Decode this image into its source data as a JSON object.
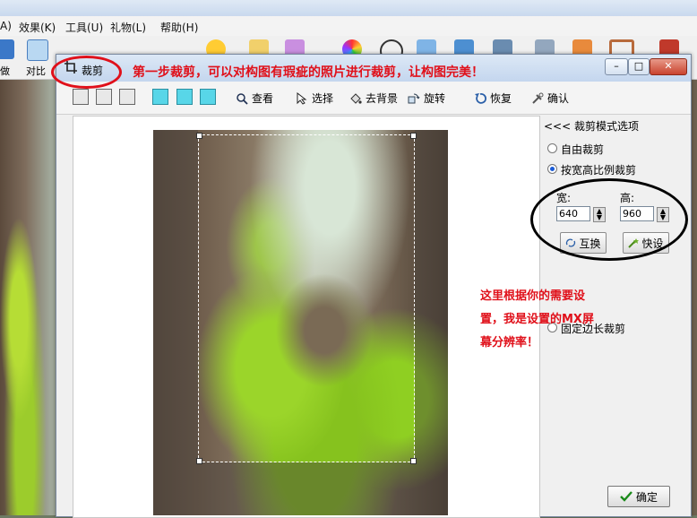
{
  "app": {
    "menu": [
      "效果(K)",
      "工具(U)",
      "礼物(L)",
      "帮助(H)"
    ],
    "toolbar_labels": {
      "compare": "对比",
      "do": "做"
    }
  },
  "dialog": {
    "title": "裁剪",
    "window_buttons": {
      "minimize": "–",
      "maximize": "□",
      "close": "✕"
    },
    "actions": [
      "查看",
      "选择",
      "去背景",
      "旋转",
      "恢复",
      "确认"
    ],
    "panel": {
      "header": "<<< 裁剪模式选项",
      "options": [
        "自由裁剪",
        "按宽高比例裁剪",
        "固定边长裁剪"
      ],
      "selected_index": 1,
      "width_label": "宽:",
      "height_label": "高:",
      "width_value": "640",
      "height_value": "960",
      "swap_button": "互换",
      "preset_button": "快设"
    },
    "ok_button": "确定"
  },
  "annotations": {
    "top": "第一步裁剪，可以对构图有瑕疵的照片进行裁剪，让构图完美！",
    "side": [
      "这里根据你的需要设",
      "置，我是设置的MX屏",
      "幕分辨率！"
    ]
  },
  "colors": {
    "annotation_red": "#e0101a",
    "accent_cyan": "#58d6e8"
  }
}
